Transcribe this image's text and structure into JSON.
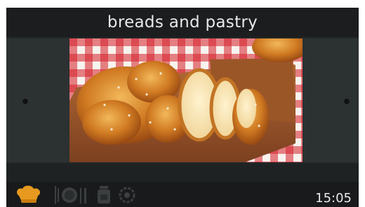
{
  "header": {
    "title": "breads and pastry"
  },
  "content": {
    "image": {
      "subject": "bread-photo"
    },
    "nav": {
      "left_icon": "dot-icon",
      "right_icon": "dot-icon"
    }
  },
  "bottom_bar": {
    "icons": [
      "chef-hat-icon",
      "plate-cutlery-icon",
      "weight-jar-icon",
      "gear-clock-icon"
    ],
    "time": "15:05"
  },
  "colors": {
    "accent": "#e79a1f",
    "bar": "#181a1b",
    "screen": "#232728"
  }
}
